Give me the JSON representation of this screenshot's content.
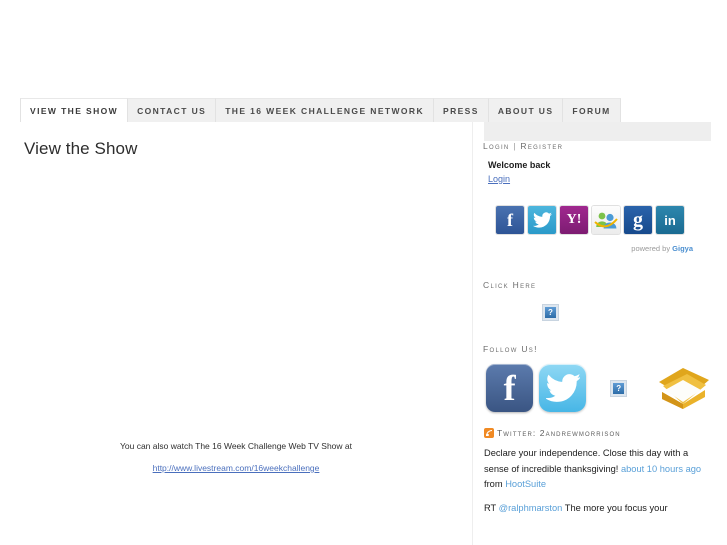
{
  "nav": {
    "tabs": [
      {
        "label": "VIEW THE SHOW",
        "active": true
      },
      {
        "label": "CONTACT US",
        "active": false
      },
      {
        "label": "THE 16 WEEK CHALLENGE NETWORK",
        "active": false
      },
      {
        "label": "PRESS",
        "active": false
      },
      {
        "label": "ABOUT US",
        "active": false
      },
      {
        "label": "FORUM",
        "active": false
      }
    ]
  },
  "main": {
    "page_title": "View the Show",
    "watch_text": "You can also watch The 16 Week Challenge Web TV Show at",
    "watch_url": "http://www.livestream.com/16weekchallenge"
  },
  "sidebar": {
    "login_widget": {
      "title_login": "Login",
      "title_separator": "|",
      "title_register": "Register",
      "welcome_text": "Welcome back",
      "login_link": "Login",
      "providers": [
        {
          "name": "facebook",
          "glyph": "f"
        },
        {
          "name": "twitter",
          "glyph": "ᵒ"
        },
        {
          "name": "yahoo",
          "glyph": "Y!"
        },
        {
          "name": "msn-messenger",
          "glyph": ""
        },
        {
          "name": "google",
          "glyph": "g"
        },
        {
          "name": "linkedin",
          "glyph": "in"
        }
      ],
      "powered_by_prefix": "powered by ",
      "powered_by_brand": "Gigya"
    },
    "click_here": {
      "title": "Click Here",
      "image_alt": "broken-image"
    },
    "follow_us": {
      "title": "Follow Us!",
      "items": [
        {
          "name": "facebook",
          "glyph": "f"
        },
        {
          "name": "twitter",
          "glyph": "t"
        },
        {
          "name": "broken-image",
          "glyph": ""
        },
        {
          "name": "email",
          "glyph": ""
        }
      ]
    },
    "twitter_feed": {
      "heading": "Twitter: 2andrewmorrison",
      "tweets": [
        {
          "text_1": "Declare your independence. Close this day with a sense of incredible thanksgiving! ",
          "link_time": "about 10 hours ago",
          "text_2": " from ",
          "link_source": "HootSuite"
        },
        {
          "text_1": "RT ",
          "link_user": "@ralphmarston",
          "text_2": " The more you focus your"
        }
      ]
    }
  },
  "colors": {
    "link": "#4a6fbd",
    "tweet_link": "#5aa0d8",
    "rss_orange": "#f08a24",
    "tab_inactive_bg": "#f0f0f0",
    "sidebar_bar": "#eeeeee"
  }
}
